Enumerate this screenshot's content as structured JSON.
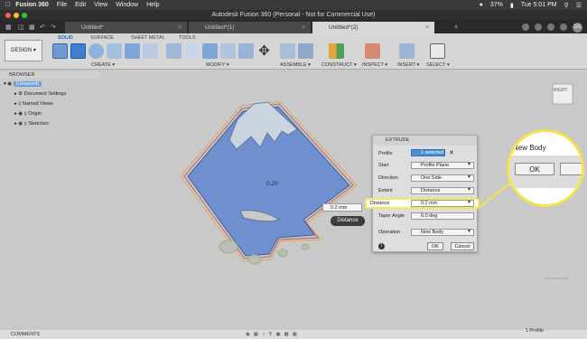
{
  "menubar": {
    "app": "Fusion 360",
    "items": [
      "File",
      "Edit",
      "View",
      "Window",
      "Help"
    ],
    "battery": "37%",
    "time": "Tue 5:01 PM"
  },
  "window": {
    "title": "Autodesk Fusion 360 (Personal - Not for Commercial Use)"
  },
  "tabs": [
    {
      "label": "Untitled*"
    },
    {
      "label": "Untitled*(1)"
    },
    {
      "label": "Untitled*(2)"
    }
  ],
  "toolbar": {
    "workspace": "DESIGN",
    "tabs": [
      "SOLID",
      "SURFACE",
      "SHEET METAL",
      "TOOLS"
    ],
    "groups": [
      "CREATE",
      "MODIFY",
      "ASSEMBLE",
      "CONSTRUCT",
      "INSPECT",
      "INSERT",
      "SELECT"
    ]
  },
  "browser": {
    "title": "BROWSER",
    "items": [
      "(Unsaved)",
      "Document Settings",
      "Named Views",
      "Origin",
      "Sketches"
    ]
  },
  "canvas": {
    "dimension": "0.20",
    "float_value": "0.2 mm",
    "float_label": "Distance",
    "viewcube": "RIGHT"
  },
  "extrude": {
    "title": "EXTRUDE",
    "rows": [
      {
        "label": "Profile",
        "value": "1 selected"
      },
      {
        "label": "Start",
        "value": "Profile Plane"
      },
      {
        "label": "Direction",
        "value": "One Side"
      },
      {
        "label": "Extent",
        "value": "Distance"
      },
      {
        "label": "Distance",
        "value": "0.2 mm"
      },
      {
        "label": "Taper Angle",
        "value": "0.0 deg"
      },
      {
        "label": "Operation",
        "value": "New Body"
      }
    ],
    "ok": "OK",
    "cancel": "Cancel"
  },
  "zoom": {
    "label": "New Body",
    "ok": "OK"
  },
  "comments": "COMMENTS",
  "status": "1 Profile"
}
